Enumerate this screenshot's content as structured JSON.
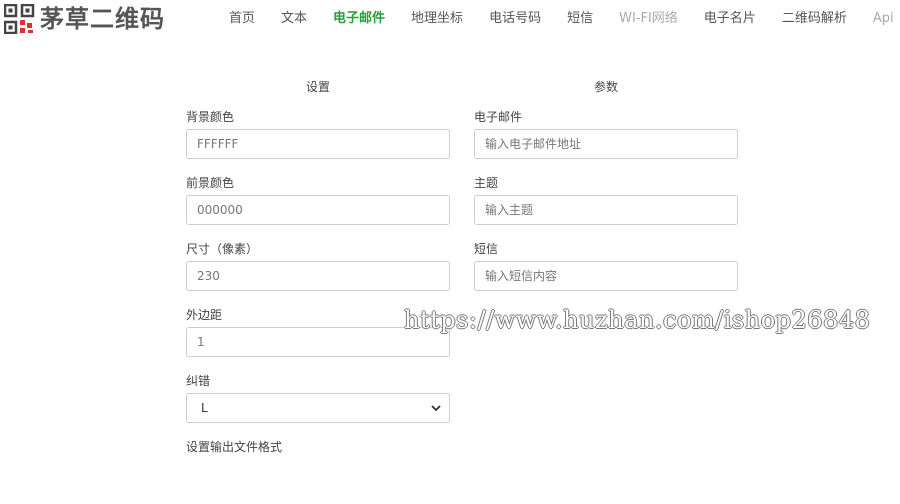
{
  "brand": {
    "name": "茅草二维码"
  },
  "nav": {
    "items": [
      {
        "label": "首页"
      },
      {
        "label": "文本"
      },
      {
        "label": "电子邮件"
      },
      {
        "label": "地理坐标"
      },
      {
        "label": "电话号码"
      },
      {
        "label": "短信"
      },
      {
        "label": "WI-FI网络"
      },
      {
        "label": "电子名片"
      },
      {
        "label": "二维码解析"
      },
      {
        "label": "Api"
      }
    ],
    "active_color": "#2a9d3d"
  },
  "settings": {
    "title": "设置",
    "background_color": {
      "label": "背景颜色",
      "placeholder": "FFFFFF"
    },
    "foreground_color": {
      "label": "前景颜色",
      "placeholder": "000000"
    },
    "size": {
      "label": "尺寸（像素）",
      "placeholder": "230"
    },
    "margin": {
      "label": "外边距",
      "placeholder": "1"
    },
    "error_correction": {
      "label": "纠错",
      "value": "L"
    },
    "output_format": {
      "label": "设置输出文件格式"
    }
  },
  "params": {
    "title": "参数",
    "email": {
      "label": "电子邮件",
      "placeholder": "输入电子邮件地址"
    },
    "subject": {
      "label": "主题",
      "placeholder": "输入主题"
    },
    "message": {
      "label": "短信",
      "placeholder": "输入短信内容"
    }
  },
  "watermark": {
    "text": "https://www.huzhan.com/ishop26848"
  }
}
